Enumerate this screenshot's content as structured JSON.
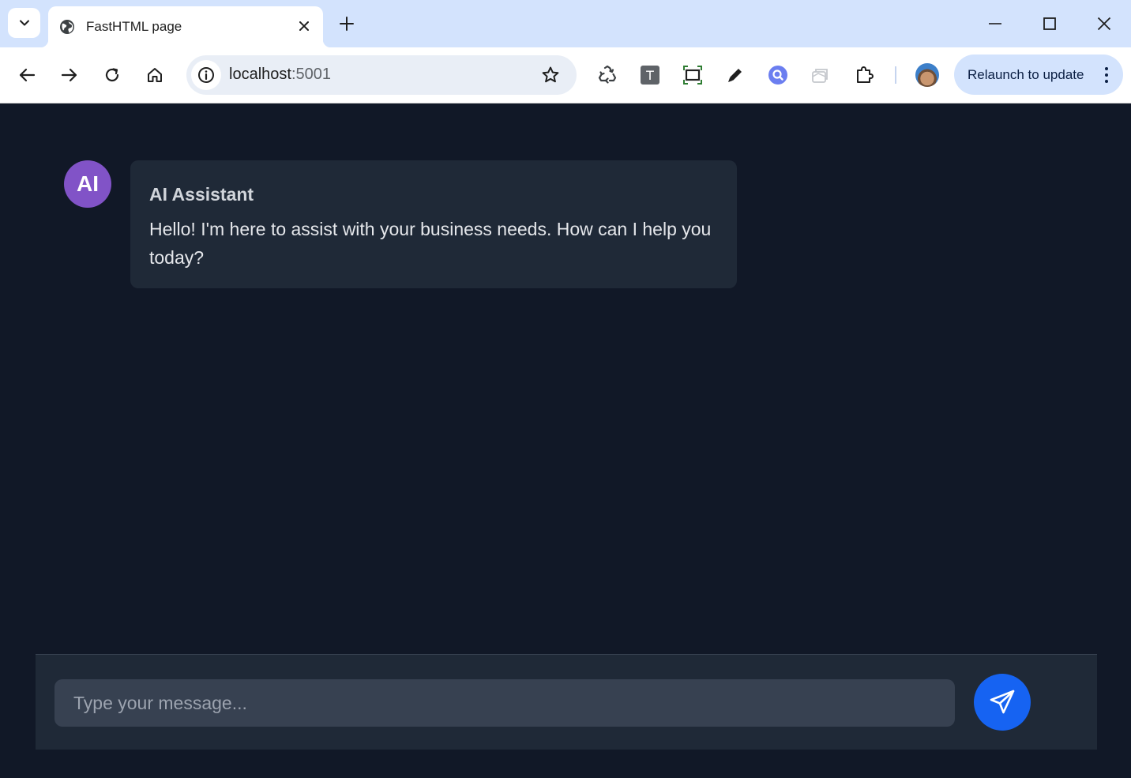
{
  "browser": {
    "tab": {
      "title": "FastHTML page"
    },
    "address": {
      "host": "localhost",
      "port": ":5001"
    },
    "relaunch_label": "Relaunch to update",
    "extension_t_label": "T"
  },
  "chat": {
    "messages": [
      {
        "avatar_initials": "AI",
        "sender": "AI Assistant",
        "text": "Hello! I'm here to assist with your business needs. How can I help you today?"
      }
    ],
    "input_placeholder": "Type your message..."
  },
  "colors": {
    "page_bg": "#111827",
    "bubble_bg": "#1f2937",
    "avatar_bg": "#8153c7",
    "send_button": "#1663f2",
    "chrome_titlebar": "#d3e3fd"
  },
  "icons": {
    "tab_search": "chevron-down-icon",
    "favicon": "globe-icon",
    "send": "send-icon"
  }
}
